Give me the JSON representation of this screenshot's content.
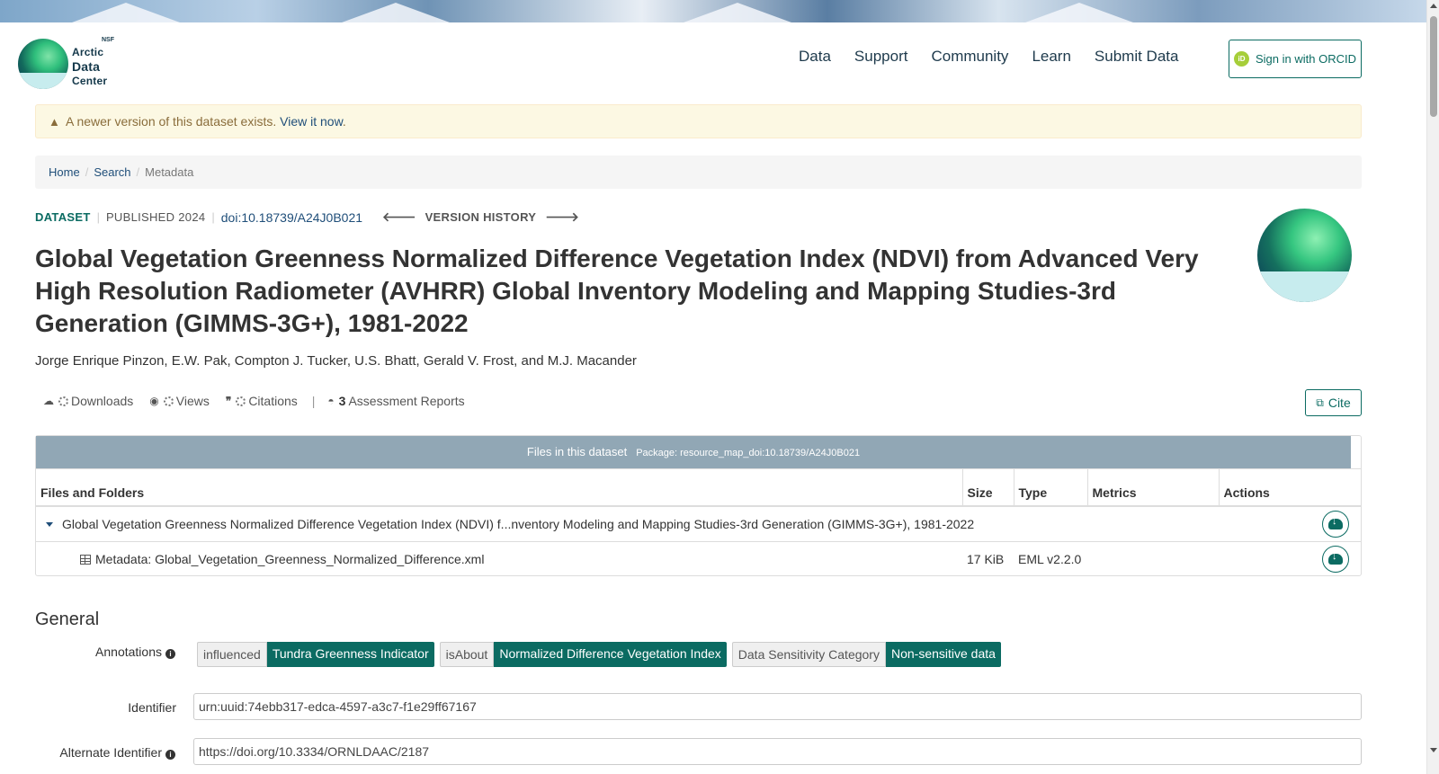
{
  "header": {
    "logo": {
      "nsf": "NSF",
      "line1": "Arctic",
      "line2": "Data",
      "line3": "Center"
    },
    "nav": [
      "Data",
      "Support",
      "Community",
      "Learn",
      "Submit Data"
    ],
    "orcid": {
      "icon": "iD",
      "label": "Sign in with ORCID"
    }
  },
  "alert": {
    "text": "A newer version of this dataset exists.",
    "link": "View it now",
    "tail": "."
  },
  "breadcrumb": {
    "home": "Home",
    "search": "Search",
    "current": "Metadata"
  },
  "meta": {
    "type": "DATASET",
    "published": "PUBLISHED 2024",
    "doi": "doi:10.18739/A24J0B021",
    "version_history": "VERSION HISTORY"
  },
  "title": "Global Vegetation Greenness Normalized Difference Vegetation Index (NDVI) from Advanced Very High Resolution Radiometer (AVHRR) Global Inventory Modeling and Mapping Studies-3rd Generation (GIMMS-3G+), 1981-2022",
  "authors": "Jorge Enrique Pinzon, E.W. Pak, Compton J. Tucker, U.S. Bhatt, Gerald V. Frost, and M.J. Macander",
  "metrics": {
    "downloads": "Downloads",
    "views": "Views",
    "citations": "Citations",
    "assessment_count": "3",
    "assessment_label": "Assessment Reports"
  },
  "cite_button": "Cite",
  "files": {
    "heading": "Files in this dataset",
    "package": "Package: resource_map_doi:10.18739/A24J0B021",
    "columns": [
      "Files and Folders",
      "Size",
      "Type",
      "Metrics",
      "Actions"
    ],
    "rows": [
      {
        "name": "Global Vegetation Greenness Normalized Difference Vegetation Index (NDVI) f...nventory Modeling and Mapping Studies-3rd Generation (GIMMS-3G+), 1981-2022",
        "size": "",
        "type": "",
        "metrics": ""
      },
      {
        "name": "Metadata: Global_Vegetation_Greenness_Normalized_Difference.xml",
        "size": "17 KiB",
        "type": "EML v2.2.0",
        "metrics": ""
      }
    ]
  },
  "general": {
    "heading": "General",
    "annotations_label": "Annotations",
    "annotations": [
      {
        "property": "influenced",
        "value": "Tundra Greenness Indicator"
      },
      {
        "property": "isAbout",
        "value": "Normalized Difference Vegetation Index"
      },
      {
        "property": "Data Sensitivity Category",
        "value": "Non-sensitive data"
      }
    ],
    "identifier_label": "Identifier",
    "identifier": "urn:uuid:74ebb317-edca-4597-a3c7-f1e29ff67167",
    "alt_identifier_label": "Alternate Identifier",
    "alt_identifier": "https://doi.org/10.3334/ORNLDAAC/2187"
  },
  "colors": {
    "brand": "#0b6b62",
    "link": "#1f4e79",
    "files_header": "#91a7b5"
  }
}
